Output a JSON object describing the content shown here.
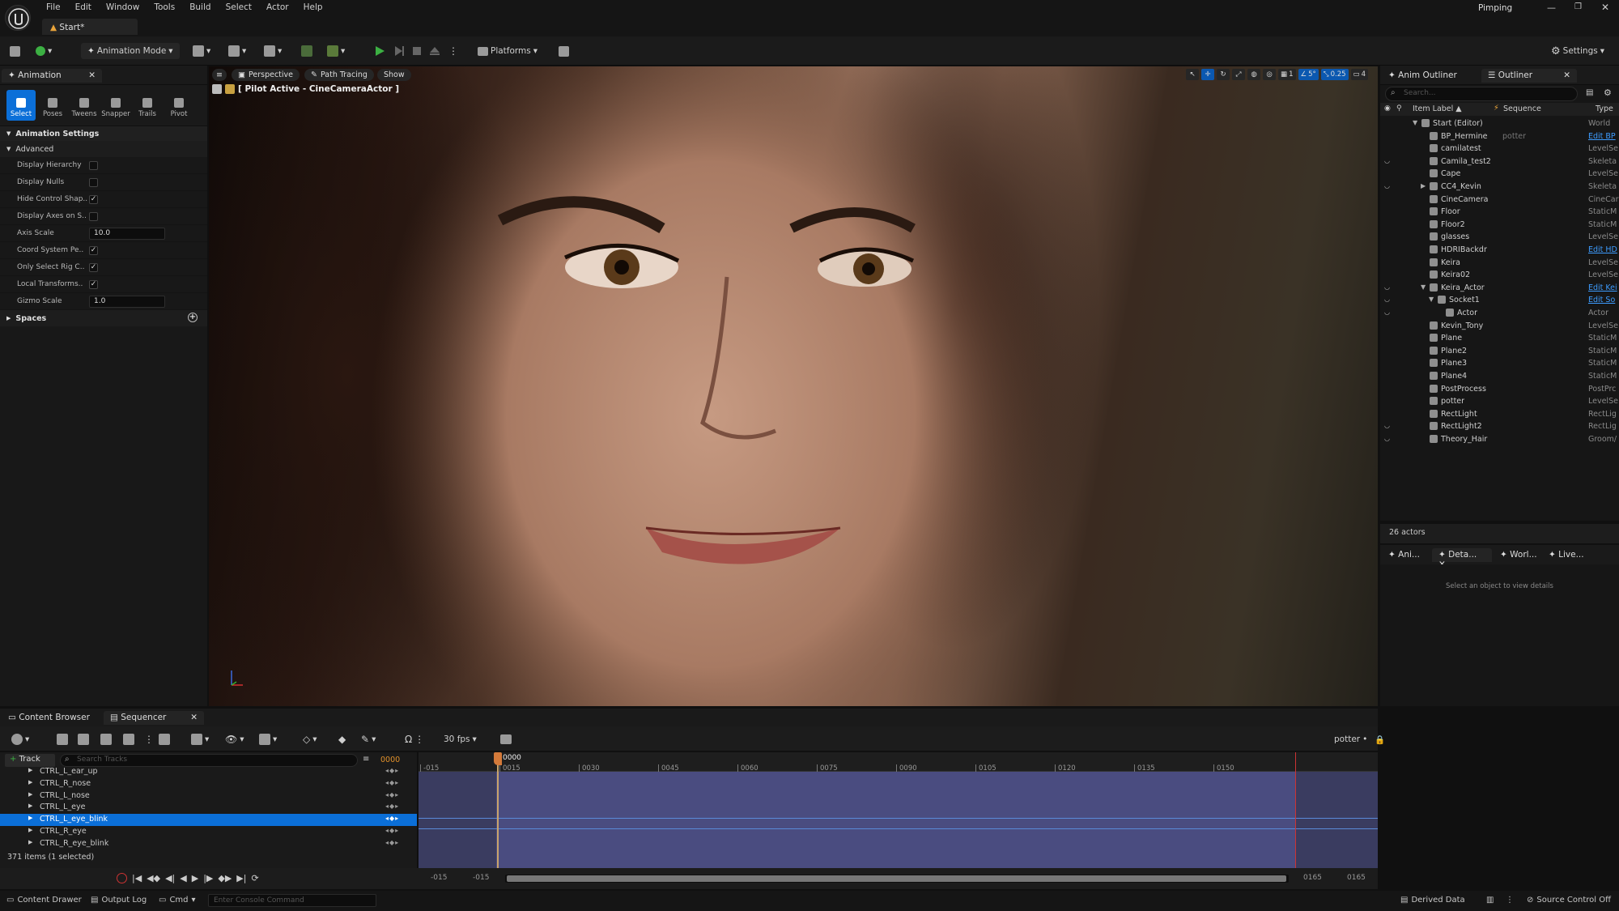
{
  "app": {
    "project_name": "Pimping",
    "level_tab": "Start*"
  },
  "menu": [
    "File",
    "Edit",
    "Window",
    "Tools",
    "Build",
    "Select",
    "Actor",
    "Help"
  ],
  "toolbar": {
    "mode_label": "Animation Mode",
    "platforms_label": "Platforms",
    "settings_label": "Settings"
  },
  "animation_panel": {
    "tab_label": "Animation",
    "modes": [
      "Select",
      "Poses",
      "Tweens",
      "Snapper",
      "Trails",
      "Pivot"
    ],
    "section_title": "Animation Settings",
    "subsection": "Advanced",
    "properties": [
      {
        "label": "Display Hierarchy",
        "kind": "check",
        "checked": false
      },
      {
        "label": "Display Nulls",
        "kind": "check",
        "checked": false
      },
      {
        "label": "Hide Control Shap..",
        "kind": "check",
        "checked": true
      },
      {
        "label": "Display Axes on S..",
        "kind": "check",
        "checked": false
      },
      {
        "label": "Axis Scale",
        "kind": "number",
        "value": "10.0"
      },
      {
        "label": "Coord System Pe..",
        "kind": "check",
        "checked": true
      },
      {
        "label": "Only Select Rig C..",
        "kind": "check",
        "checked": true
      },
      {
        "label": "Local Transforms..",
        "kind": "check",
        "checked": true
      },
      {
        "label": "Gizmo Scale",
        "kind": "number",
        "value": "1.0"
      }
    ],
    "spaces_label": "Spaces"
  },
  "viewport": {
    "perspective_label": "Perspective",
    "path_tracing_label": "Path Tracing",
    "show_label": "Show",
    "pilot_label": "[ Pilot Active - CineCameraActor ]",
    "grid_value": "1",
    "angle_value": "5°",
    "scale_value": "0.25",
    "camera_speed": "4"
  },
  "outliner": {
    "tabs": [
      "Anim Outliner",
      "Outliner"
    ],
    "search_placeholder": "Search...",
    "columns": {
      "label": "Item Label ▲",
      "sequence": "Sequence",
      "type": "Type"
    },
    "items": [
      {
        "label": "Start (Editor)",
        "type": "World",
        "indent": 0,
        "arrow": "▼",
        "eye": false,
        "seq": "",
        "link": false
      },
      {
        "label": "BP_Hermine",
        "type": "Edit BP",
        "indent": 1,
        "arrow": "",
        "eye": false,
        "seq": "potter",
        "link": true
      },
      {
        "label": "camilatest",
        "type": "LevelSe",
        "indent": 1,
        "arrow": "",
        "eye": false,
        "seq": "",
        "link": false
      },
      {
        "label": "Camila_test2",
        "type": "Skeleta",
        "indent": 1,
        "arrow": "",
        "eye": true,
        "seq": "",
        "link": false
      },
      {
        "label": "Cape",
        "type": "LevelSe",
        "indent": 1,
        "arrow": "",
        "eye": false,
        "seq": "",
        "link": false
      },
      {
        "label": "CC4_Kevin",
        "type": "Skeleta",
        "indent": 1,
        "arrow": "▶",
        "eye": true,
        "seq": "",
        "link": false
      },
      {
        "label": "CineCamera",
        "type": "CineCar",
        "indent": 1,
        "arrow": "",
        "eye": false,
        "seq": "",
        "link": false
      },
      {
        "label": "Floor",
        "type": "StaticM",
        "indent": 1,
        "arrow": "",
        "eye": false,
        "seq": "",
        "link": false
      },
      {
        "label": "Floor2",
        "type": "StaticM",
        "indent": 1,
        "arrow": "",
        "eye": false,
        "seq": "",
        "link": false
      },
      {
        "label": "glasses",
        "type": "LevelSe",
        "indent": 1,
        "arrow": "",
        "eye": false,
        "seq": "",
        "link": false
      },
      {
        "label": "HDRIBackdr",
        "type": "Edit HD",
        "indent": 1,
        "arrow": "",
        "eye": false,
        "seq": "",
        "link": true
      },
      {
        "label": "Keira",
        "type": "LevelSe",
        "indent": 1,
        "arrow": "",
        "eye": false,
        "seq": "",
        "link": false
      },
      {
        "label": "Keira02",
        "type": "LevelSe",
        "indent": 1,
        "arrow": "",
        "eye": false,
        "seq": "",
        "link": false
      },
      {
        "label": "Keira_Actor",
        "type": "Edit Kei",
        "indent": 1,
        "arrow": "▼",
        "eye": true,
        "seq": "",
        "link": true
      },
      {
        "label": "Socket1",
        "type": "Edit So",
        "indent": 2,
        "arrow": "▼",
        "eye": true,
        "seq": "",
        "link": true
      },
      {
        "label": "Actor",
        "type": "Actor",
        "indent": 3,
        "arrow": "",
        "eye": true,
        "seq": "",
        "link": false
      },
      {
        "label": "Kevin_Tony",
        "type": "LevelSe",
        "indent": 1,
        "arrow": "",
        "eye": false,
        "seq": "",
        "link": false
      },
      {
        "label": "Plane",
        "type": "StaticM",
        "indent": 1,
        "arrow": "",
        "eye": false,
        "seq": "",
        "link": false
      },
      {
        "label": "Plane2",
        "type": "StaticM",
        "indent": 1,
        "arrow": "",
        "eye": false,
        "seq": "",
        "link": false
      },
      {
        "label": "Plane3",
        "type": "StaticM",
        "indent": 1,
        "arrow": "",
        "eye": false,
        "seq": "",
        "link": false
      },
      {
        "label": "Plane4",
        "type": "StaticM",
        "indent": 1,
        "arrow": "",
        "eye": false,
        "seq": "",
        "link": false
      },
      {
        "label": "PostProcess",
        "type": "PostPrc",
        "indent": 1,
        "arrow": "",
        "eye": false,
        "seq": "",
        "link": false
      },
      {
        "label": "potter",
        "type": "LevelSe",
        "indent": 1,
        "arrow": "",
        "eye": false,
        "seq": "",
        "link": false
      },
      {
        "label": "RectLight",
        "type": "RectLig",
        "indent": 1,
        "arrow": "",
        "eye": false,
        "seq": "",
        "link": false
      },
      {
        "label": "RectLight2",
        "type": "RectLig",
        "indent": 1,
        "arrow": "",
        "eye": true,
        "seq": "",
        "link": false
      },
      {
        "label": "Theory_Hair",
        "type": "Groom/",
        "indent": 1,
        "arrow": "",
        "eye": true,
        "seq": "",
        "link": false
      }
    ],
    "actor_count": "26 actors"
  },
  "details": {
    "tabs": [
      "Ani...",
      "Deta...",
      "Worl...",
      "Live..."
    ],
    "empty_message": "Select an object to view details"
  },
  "bottom_tabs": {
    "content_browser": "Content Browser",
    "sequencer": "Sequencer"
  },
  "sequencer": {
    "add_track_label": "Track",
    "search_placeholder": "Search Tracks",
    "current_frame": "0000",
    "fps_label": "30 fps",
    "sequence_name": "potter",
    "tracks": [
      {
        "name": "CTRL_L_ear_up",
        "selected": false
      },
      {
        "name": "CTRL_R_nose",
        "selected": false
      },
      {
        "name": "CTRL_L_nose",
        "selected": false
      },
      {
        "name": "CTRL_L_eye",
        "selected": false
      },
      {
        "name": "CTRL_L_eye_blink",
        "selected": true
      },
      {
        "name": "CTRL_R_eye",
        "selected": false
      },
      {
        "name": "CTRL_R_eye_blink",
        "selected": false
      }
    ],
    "item_count": "371 items (1 selected)",
    "ruler_labels": [
      "-015",
      "0015",
      "0030",
      "0045",
      "0060",
      "0075",
      "0090",
      "0105",
      "0120",
      "0135",
      "0150"
    ],
    "playhead_label": "0000",
    "range_start_a": "-015",
    "range_start_b": "-015",
    "range_end_a": "0165",
    "range_end_b": "0165"
  },
  "statusbar": {
    "content_drawer": "Content Drawer",
    "output_log": "Output Log",
    "cmd": "Cmd",
    "console_placeholder": "Enter Console Command",
    "derived_data": "Derived Data",
    "source_control": "Source Control Off"
  },
  "colors": {
    "accent": "#0b6fd8",
    "play_green": "#3cb043",
    "playhead": "#d47a3a",
    "link": "#3d9cff"
  }
}
